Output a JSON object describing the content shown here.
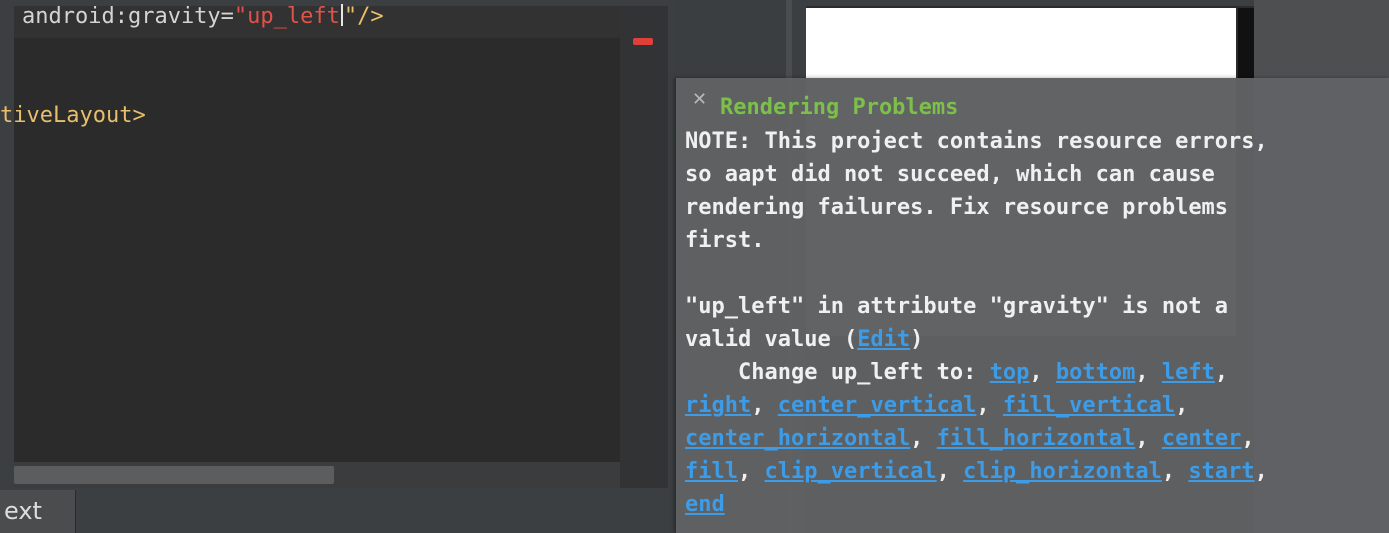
{
  "editor": {
    "line1": {
      "attribute": "android:gravity=",
      "quote_open": "\"",
      "value": "up_left",
      "closing": "\"/>"
    },
    "line2": "tiveLayout>"
  },
  "bottom_tab": {
    "label": "ext"
  },
  "problems": {
    "title": "Rendering Problems",
    "note_lines": [
      "NOTE: This project contains resource errors,",
      "so aapt did not succeed, which can cause",
      "rendering failures. Fix resource problems",
      "first."
    ],
    "error_line1": "\"up_left\" in attribute \"gravity\" is not a",
    "error_line2_prefix": "valid value (",
    "edit_link": "Edit",
    "error_line2_suffix": ")",
    "change_prefix": "    Change up_left to: ",
    "options": [
      "top",
      "bottom",
      "left",
      "right",
      "center_vertical",
      "fill_vertical",
      "center_horizontal",
      "fill_horizontal",
      "center",
      "fill",
      "clip_vertical",
      "clip_horizontal",
      "start",
      "end"
    ],
    "separator": ","
  },
  "colors": {
    "title_green": "#7cc04a",
    "link_blue": "#3d9ce8",
    "error_red": "#e0403a",
    "string_red": "#e0524a",
    "tag_yellow": "#e8bf6a"
  }
}
